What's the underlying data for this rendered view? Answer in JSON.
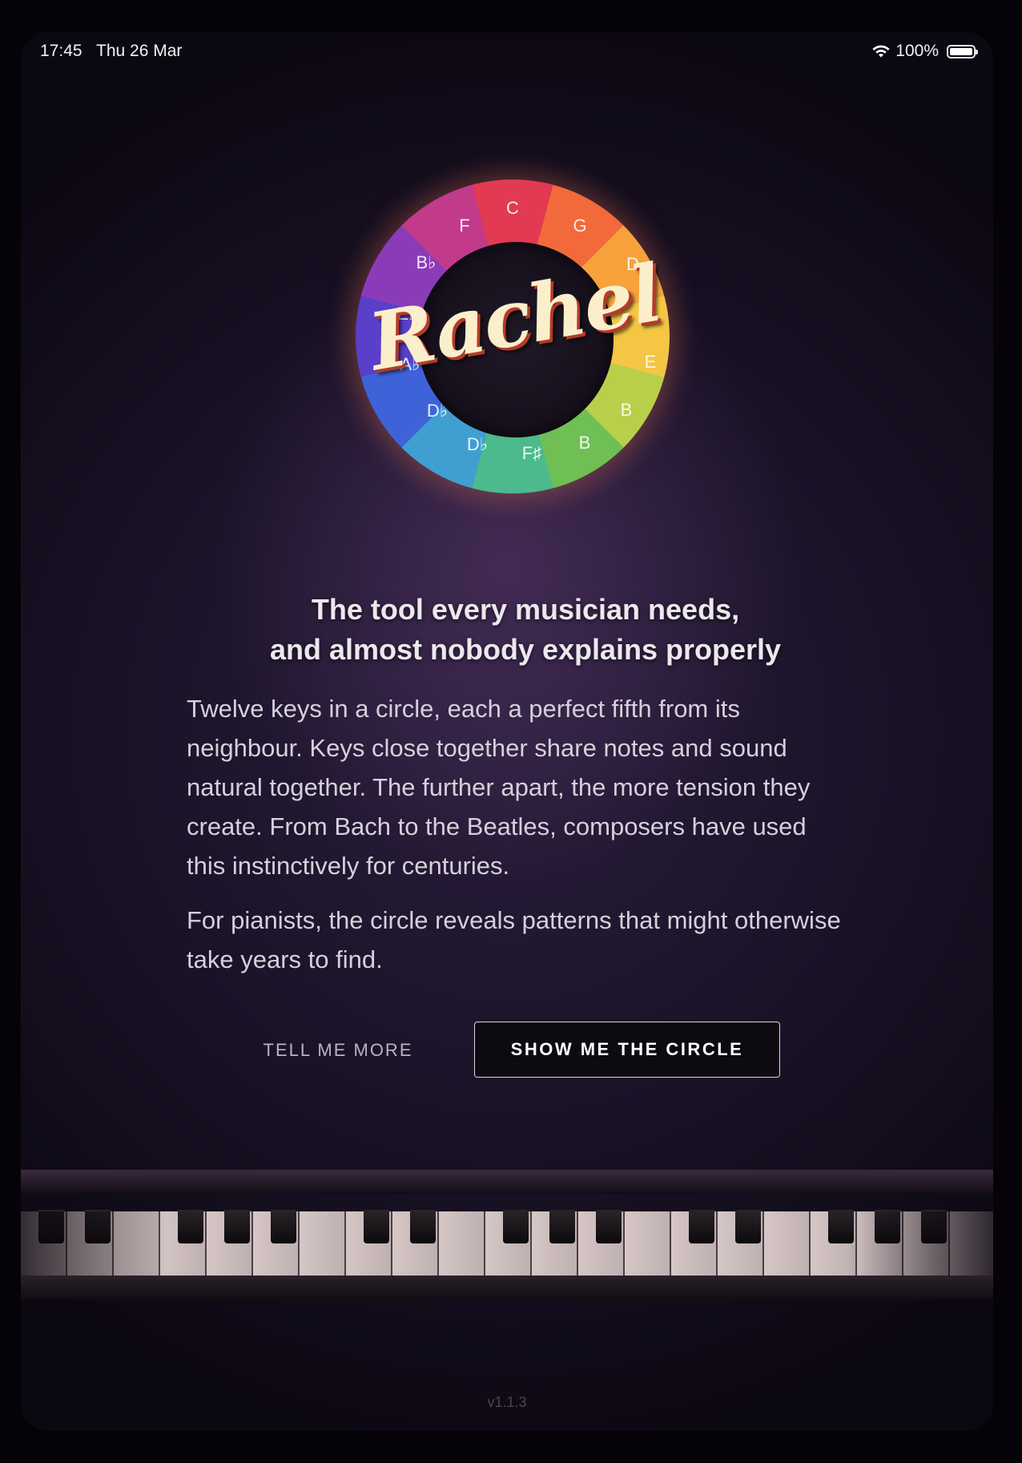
{
  "status": {
    "time": "17:45",
    "date": "Thu 26 Mar",
    "battery": "100%",
    "icons": [
      "wifi-icon",
      "battery-icon"
    ]
  },
  "logo": {
    "wordmark": "Rachel",
    "wheel_keys": [
      "C",
      "G",
      "D",
      "A",
      "E",
      "B",
      "B",
      "F♯",
      "D♭",
      "D♭",
      "A♭",
      "E♭",
      "B♭",
      "F"
    ]
  },
  "headline": {
    "line1": "The tool every musician needs,",
    "line2": "and almost nobody explains properly"
  },
  "body": {
    "paragraph1": "Twelve keys in a circle, each a perfect fifth from its neighbour. Keys close together share notes and sound natural together. The further apart, the more tension they create. From Bach to the Beatles, composers have used this instinctively for centuries.",
    "paragraph2": "For pianists, the circle reveals patterns that might otherwise take years to find."
  },
  "actions": {
    "tell_more": "TELL ME MORE",
    "show_circle": "SHOW ME THE CIRCLE"
  },
  "footer": {
    "version": "v1.1.3"
  },
  "colors": {
    "background": "#1a1227",
    "button_border": "#d8d4dc",
    "wordmark": "#fbeecb"
  }
}
